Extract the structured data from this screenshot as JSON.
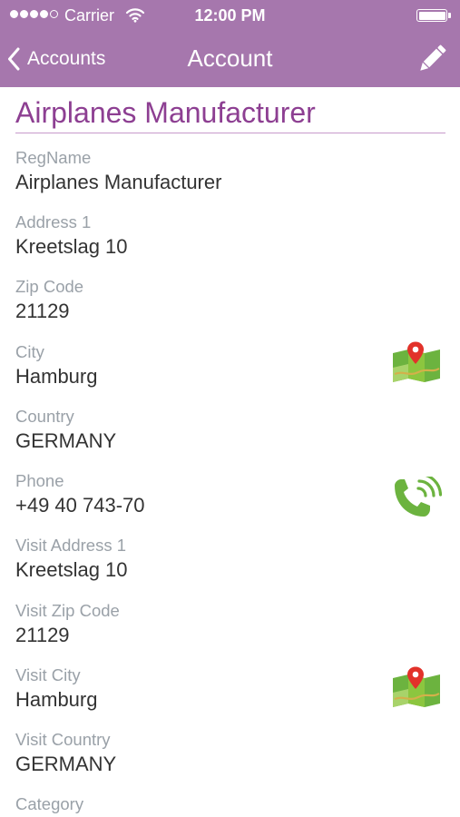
{
  "status_bar": {
    "carrier": "Carrier",
    "time": "12:00 PM",
    "signal_bars_filled": 4,
    "signal_bars_total": 5
  },
  "nav": {
    "back_label": "Accounts",
    "title": "Account",
    "edit_icon": "pencil-icon"
  },
  "account": {
    "name": "Airplanes Manufacturer"
  },
  "fields": [
    {
      "label": "RegName",
      "value": "Airplanes Manufacturer"
    },
    {
      "label": "Address 1",
      "value": "Kreetslag 10"
    },
    {
      "label": "Zip Code",
      "value": "21129"
    },
    {
      "label": "City",
      "value": "Hamburg",
      "action_icon": "map-icon"
    },
    {
      "label": "Country",
      "value": "GERMANY"
    },
    {
      "label": "Phone",
      "value": "+49 40 743-70",
      "action_icon": "phone-icon"
    },
    {
      "label": "Visit Address 1",
      "value": "Kreetslag 10"
    },
    {
      "label": "Visit Zip Code",
      "value": "21129"
    },
    {
      "label": "Visit City",
      "value": "Hamburg",
      "action_icon": "map-icon"
    },
    {
      "label": "Visit Country",
      "value": "GERMANY"
    },
    {
      "label": "Category",
      "value": ""
    }
  ],
  "colors": {
    "header": "#a677ad",
    "title": "#8d3f92",
    "label": "#9aa1a8",
    "value": "#333333",
    "icon_green": "#6cb33f",
    "pin_red": "#e2322a"
  }
}
